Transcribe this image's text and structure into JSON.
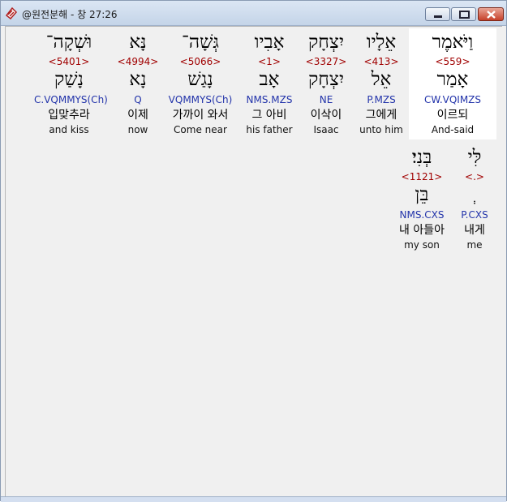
{
  "window": {
    "title": "@원전분해 - 창 27:26",
    "accent": "#c6402a"
  },
  "row1": [
    {
      "heb": "וַיֹּאמֶר",
      "strong": "<559>",
      "lemma": "אָמַר",
      "parse": "CW.VQIMZS",
      "kor": "이르되",
      "eng": "And-said"
    },
    {
      "heb": "אֵלָיו",
      "strong": "<413>",
      "lemma": "אֵל",
      "parse": "P.MZS",
      "kor": "그에게",
      "eng": "unto him"
    },
    {
      "heb": "יִצְחָק",
      "strong": "<3327>",
      "lemma": "יִצְחָק",
      "parse": "NE",
      "kor": "이삭이",
      "eng": "Isaac"
    },
    {
      "heb": "אָבִיו",
      "strong": "<1>",
      "lemma": "אָב",
      "parse": "NMS.MZS",
      "kor": "그 아비",
      "eng": "his father"
    },
    {
      "heb": "גְּשָׁה־",
      "strong": "<5066>",
      "lemma": "נָגַשׁ",
      "parse": "VQMMYS(Ch)",
      "kor": "가까이 와서",
      "eng": "Come near"
    },
    {
      "heb": "נָּא",
      "strong": "<4994>",
      "lemma": "נָא",
      "parse": "Q",
      "kor": "이제",
      "eng": "now"
    },
    {
      "heb": "וּשְׁקָה־",
      "strong": "<5401>",
      "lemma": "נָשַׁק",
      "parse": "C.VQMMYS(Ch)",
      "kor": "입맞추라",
      "eng": "and kiss"
    }
  ],
  "row2": [
    {
      "heb": "לִּי",
      "strong": "<.>",
      "lemma": "ְ",
      "parse": "P.CXS",
      "kor": "내게",
      "eng": "me"
    },
    {
      "heb": "בְּנִי׃",
      "strong": "<1121>",
      "lemma": "בֵּן",
      "parse": "NMS.CXS",
      "kor": "내 아들아",
      "eng": "my son"
    }
  ]
}
